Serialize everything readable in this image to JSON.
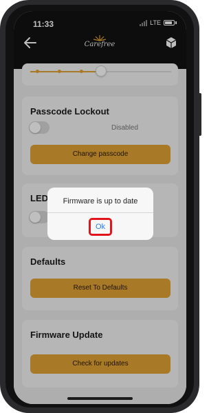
{
  "status_bar": {
    "time": "11:33",
    "network": "LTE"
  },
  "header": {
    "logo_text": "Carefree"
  },
  "passcode_lockout": {
    "title": "Passcode Lockout",
    "toggle_status": "Disabled",
    "button_label": "Change passcode"
  },
  "led_section": {
    "title": "LED"
  },
  "defaults": {
    "title": "Defaults",
    "button_label": "Reset To Defaults"
  },
  "firmware_update": {
    "title": "Firmware Update",
    "button_label": "Check for updates"
  },
  "dialog": {
    "message": "Firmware is up to date",
    "ok_label": "Ok"
  },
  "slider": {
    "value_fraction": 0.5
  },
  "colors": {
    "accent": "#e0a233",
    "link": "#2a7df5",
    "highlight": "#e0141a"
  }
}
